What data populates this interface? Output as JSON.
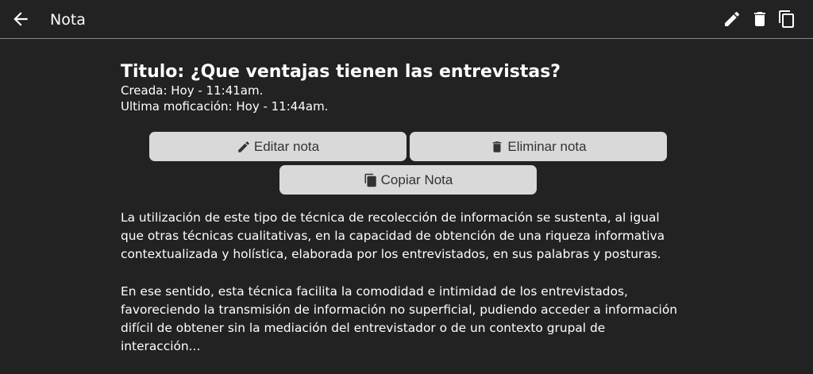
{
  "header": {
    "title": "Nota",
    "back_icon": "arrow-left-icon",
    "actions": [
      "pencil-icon",
      "trash-icon",
      "copy-icon"
    ]
  },
  "note": {
    "title": "Titulo: ¿Que ventajas tienen las entrevistas?",
    "created": "Creada: Hoy - 11:41am.",
    "modified": "Ultima moficación: Hoy - 11:44am.",
    "paragraphs": [
      "La utilización de este tipo de técnica de recolección de información se sustenta, al igual que otras técnicas cualitativas, en la capacidad de obtención de una riqueza informativa contextualizada y holística, elaborada por los entrevistados, en sus palabras y posturas.",
      "En ese sentido, esta técnica facilita la comodidad e intimidad de los entrevistados, favoreciendo la transmisión de información no superficial, pudiendo acceder a información difícil de obtener sin la mediación del entrevistador o de un contexto grupal de interacción..."
    ]
  },
  "buttons": {
    "edit": "Editar nota",
    "delete": "Eliminar nota",
    "copy": "Copiar Nota"
  },
  "colors": {
    "background": "#222222",
    "button_bg": "#d9d9d9",
    "button_text": "#333333",
    "text": "#ffffff"
  }
}
